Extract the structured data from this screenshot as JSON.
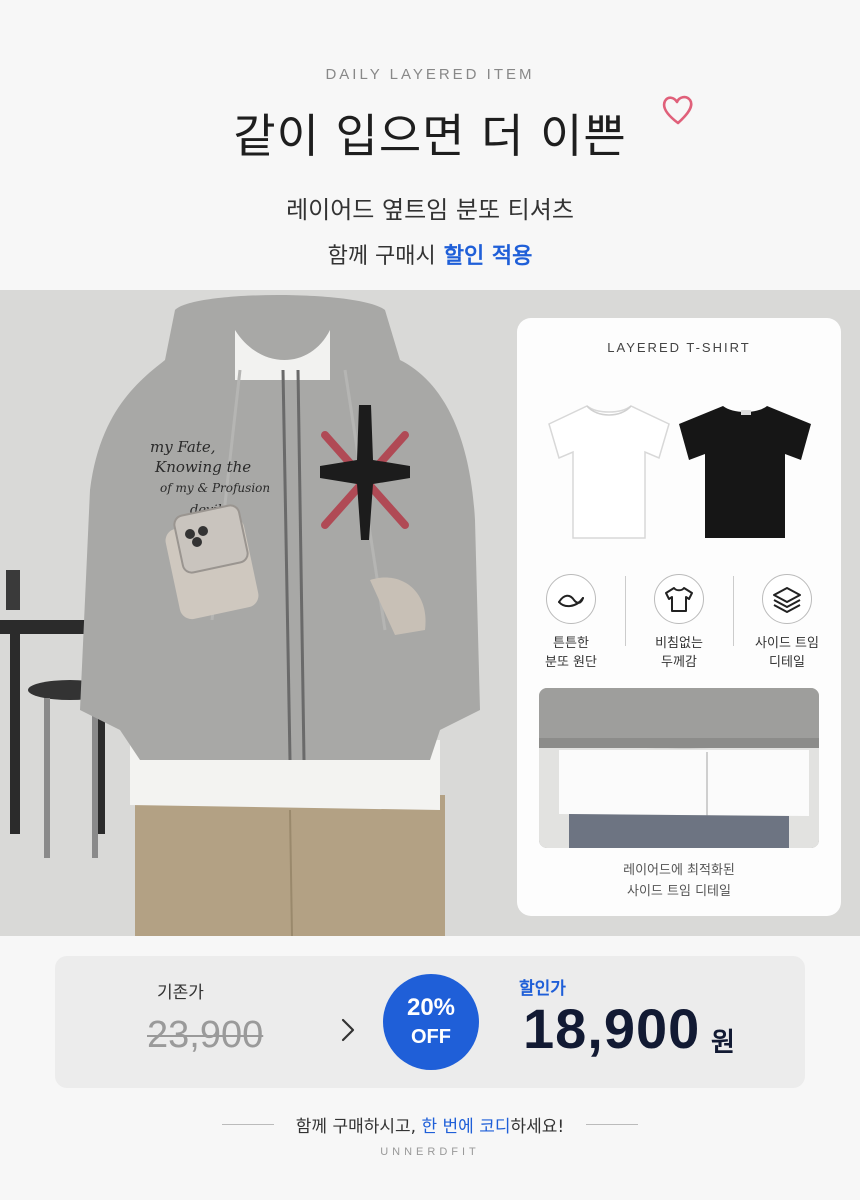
{
  "header": {
    "eyebrow": "DAILY LAYERED ITEM",
    "headline": "같이 입으면 더 이쁜",
    "subtitle": "레이어드 옆트임 분또 티셔츠",
    "discount_prefix": "함께 구매시",
    "discount_highlight": "할인 적용"
  },
  "photo": {
    "print_text": [
      "my Fate,",
      "Knowing the",
      "of my & Profusion",
      "devil"
    ]
  },
  "card": {
    "title": "LAYERED T-SHIRT",
    "features": [
      {
        "icon": "fabric-icon",
        "line1": "튼튼한",
        "line2": "분또 원단"
      },
      {
        "icon": "tshirt-icon",
        "line1": "비침없는",
        "line2": "두께감"
      },
      {
        "icon": "layers-icon",
        "line1": "사이드 트임",
        "line2": "디테일"
      }
    ],
    "caption_line1": "레이어드에 최적화된",
    "caption_line2": "사이드 트임 디테일"
  },
  "price": {
    "original_label": "기존가",
    "original_price": "23,900",
    "badge_percent": "20%",
    "badge_off": "OFF",
    "sale_label": "할인가",
    "sale_price": "18,900",
    "currency": "원"
  },
  "footer": {
    "text_prefix": "함께 구매하시고, ",
    "text_highlight": "한 번에 코디",
    "text_suffix": "하세요!",
    "brand": "UNNERDFIT"
  },
  "colors": {
    "accent": "#1f5fd8",
    "price_dark": "#121a33",
    "heart": "#e0607a"
  }
}
